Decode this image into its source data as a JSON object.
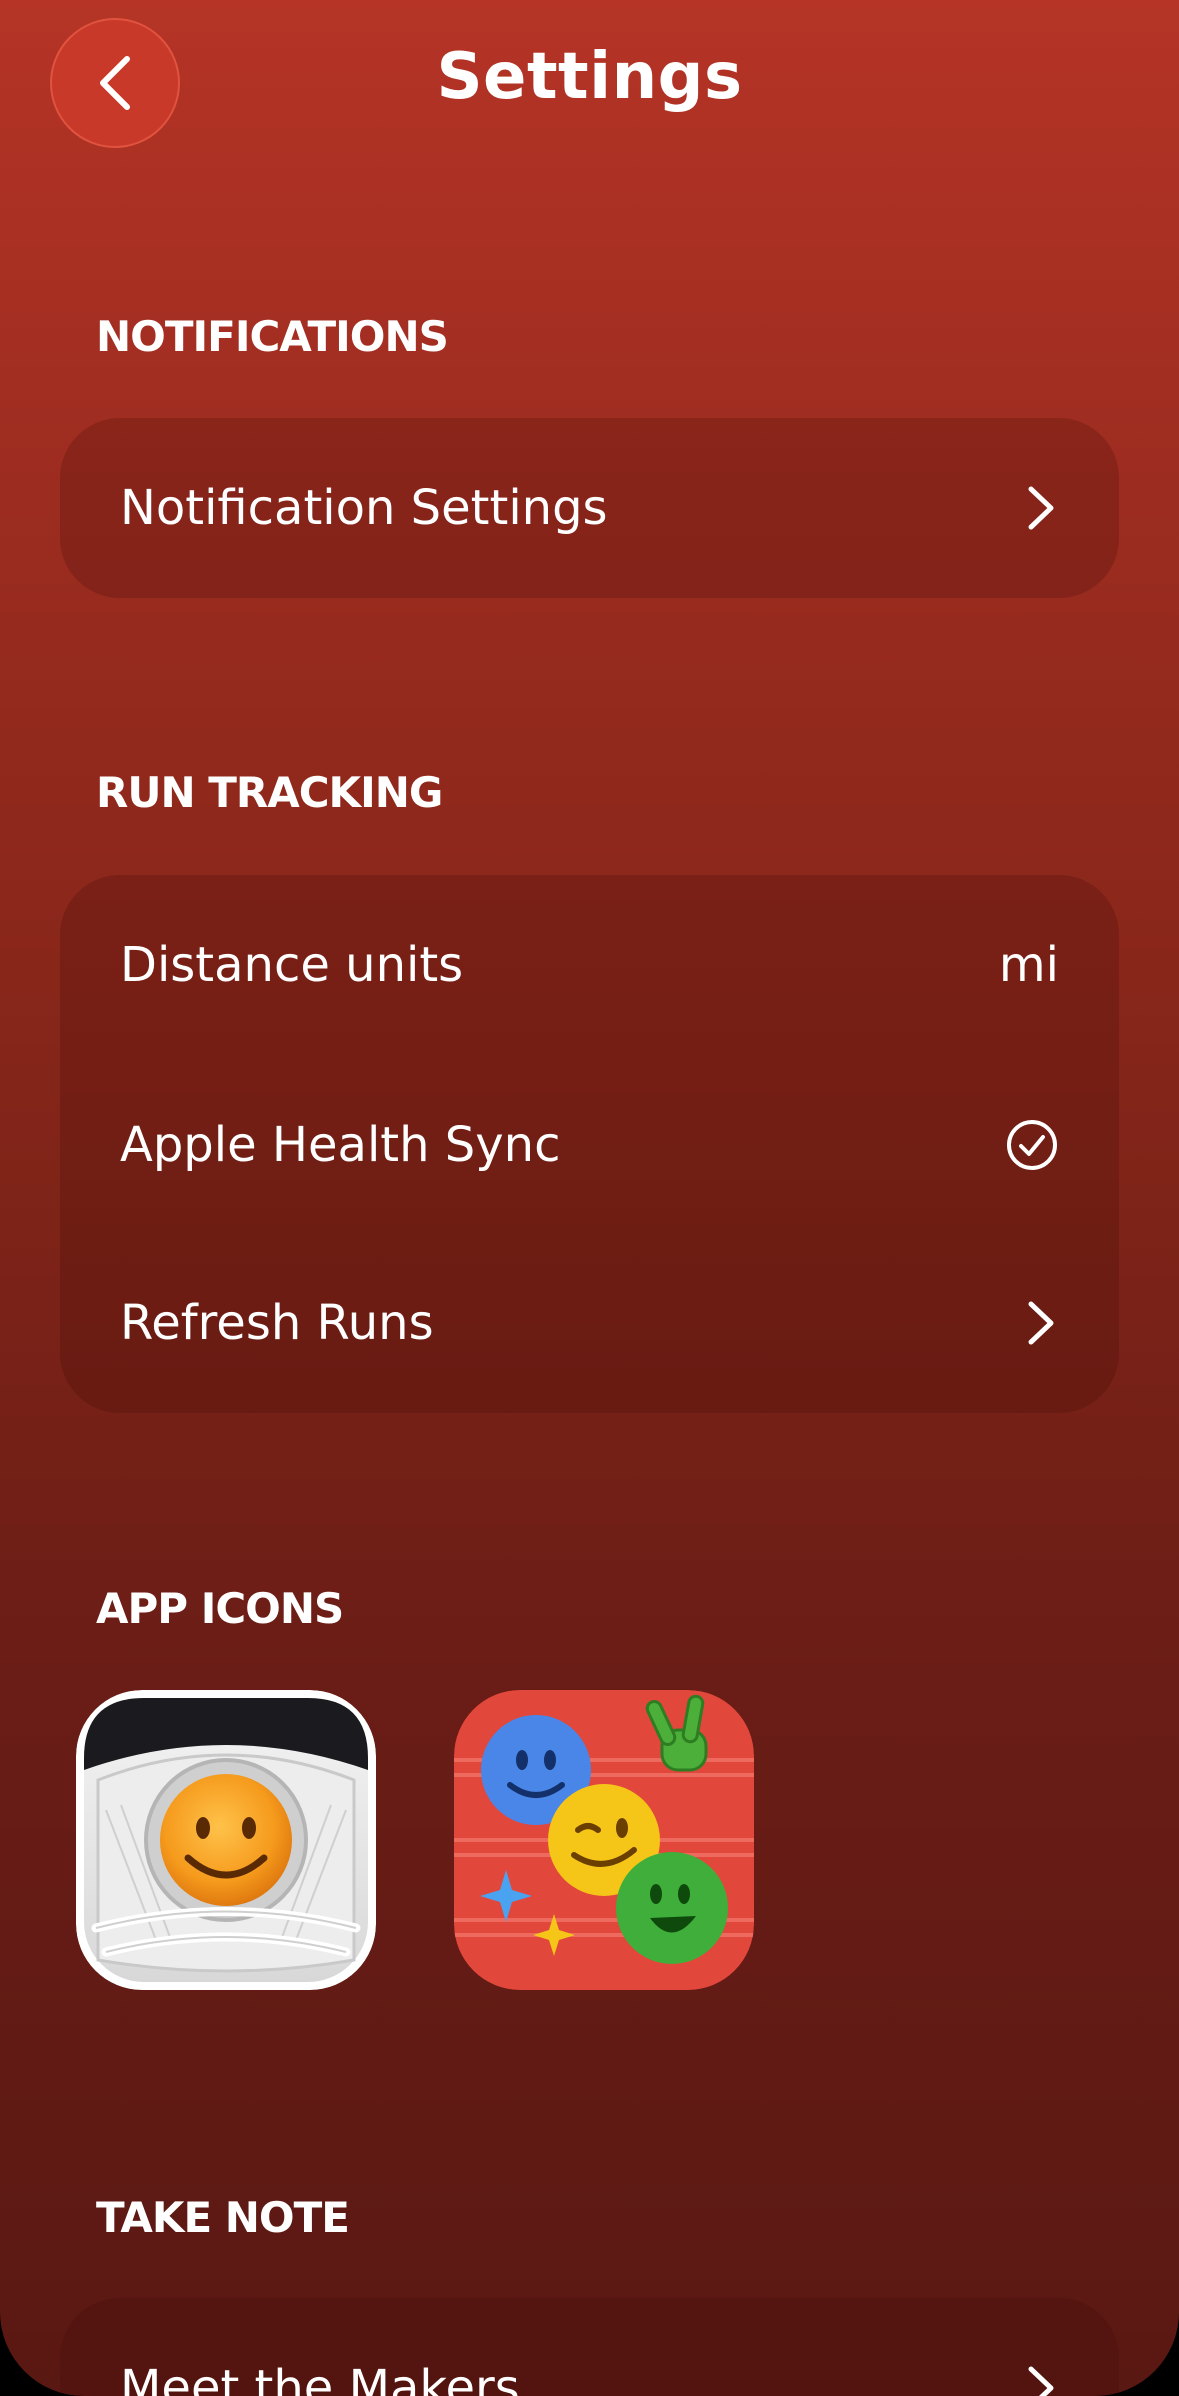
{
  "header": {
    "title": "Settings"
  },
  "sections": {
    "notifications": {
      "title": "NOTIFICATIONS",
      "items": [
        {
          "label": "Notification Settings",
          "icon": "chevron-right-icon"
        }
      ]
    },
    "run_tracking": {
      "title": "RUN TRACKING",
      "items": [
        {
          "label": "Distance units",
          "value": "mi"
        },
        {
          "label": "Apple Health Sync",
          "icon": "checkmark-circle-icon"
        },
        {
          "label": "Refresh Runs",
          "icon": "chevron-right-icon"
        }
      ]
    },
    "app_icons": {
      "title": "APP ICONS",
      "items": [
        {
          "icon": "smiley-sneaker-app-icon"
        },
        {
          "icon": "emoji-faces-app-icon"
        }
      ]
    },
    "take_note": {
      "title": "TAKE NOTE",
      "items": [
        {
          "label": "Meet the Makers",
          "icon": "chevron-right-icon"
        }
      ]
    }
  },
  "colors": {
    "background_top": "#b53426",
    "background_bottom": "#5a1813",
    "back_button": "#c8392a"
  }
}
